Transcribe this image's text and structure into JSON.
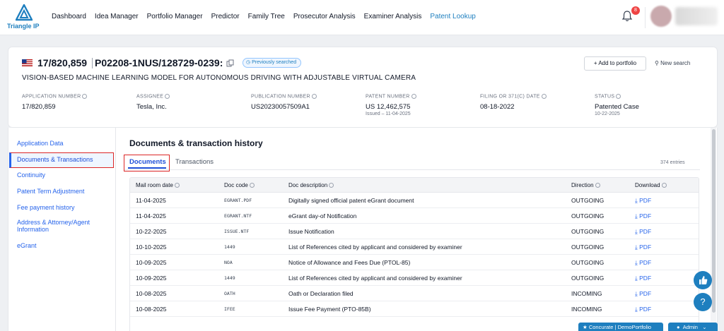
{
  "brand": {
    "name": "Triangle IP",
    "color": "#1e7fbf"
  },
  "nav": {
    "items": [
      "Dashboard",
      "Idea Manager",
      "Portfolio Manager",
      "Predictor",
      "Family Tree",
      "Prosecutor Analysis",
      "Examiner Analysis",
      "Patent Lookup"
    ],
    "active": "Patent Lookup"
  },
  "notifications": {
    "count": "8"
  },
  "header": {
    "application_number": "17/820,859",
    "docket": "P02208-1NUS/128729-0239:",
    "badge": "Previously searched",
    "title": "VISION-BASED MACHINE LEARNING MODEL FOR AUTONOMOUS DRIVING WITH ADJUSTABLE VIRTUAL CAMERA",
    "add_portfolio": "+ Add to portfolio",
    "new_search": "New search",
    "fields": [
      {
        "label": "APPLICATION NUMBER",
        "value": "17/820,859",
        "sub": ""
      },
      {
        "label": "ASSIGNEE",
        "value": "Tesla, Inc.",
        "sub": ""
      },
      {
        "label": "PUBLICATION NUMBER",
        "value": "US20230057509A1",
        "sub": ""
      },
      {
        "label": "PATENT NUMBER",
        "value": "US 12,462,575",
        "sub": "Issued – 11-04-2025"
      },
      {
        "label": "FILING OR 371(C) DATE",
        "value": "08-18-2022",
        "sub": ""
      },
      {
        "label": "STATUS",
        "value": "Patented Case",
        "sub": "10-22-2025"
      }
    ]
  },
  "sidebar": {
    "items": [
      "Application Data",
      "Documents & Transactions",
      "Continuity",
      "Patent Term Adjustment",
      "Fee payment history",
      "Address & Attorney/Agent Information",
      "eGrant"
    ],
    "active": "Documents & Transactions"
  },
  "main": {
    "section_title": "Documents & transaction history",
    "tabs": [
      "Documents",
      "Transactions"
    ],
    "entries": "374 entries",
    "columns": [
      "Mail room date",
      "Doc code",
      "Doc description",
      "Direction",
      "Download"
    ],
    "rows": [
      {
        "date": "11-04-2025",
        "code": "EGRANT.PDF",
        "desc": "Digitally signed official patent eGrant document",
        "dir": "OUTGOING",
        "dl": "PDF"
      },
      {
        "date": "11-04-2025",
        "code": "EGRANT.NTF",
        "desc": "eGrant day-of Notification",
        "dir": "OUTGOING",
        "dl": "PDF"
      },
      {
        "date": "10-22-2025",
        "code": "ISSUE.NTF",
        "desc": "Issue Notification",
        "dir": "OUTGOING",
        "dl": "PDF"
      },
      {
        "date": "10-10-2025",
        "code": "1449",
        "desc": "List of References cited by applicant and considered by examiner",
        "dir": "OUTGOING",
        "dl": "PDF"
      },
      {
        "date": "10-09-2025",
        "code": "NOA",
        "desc": "Notice of Allowance and Fees Due (PTOL-85)",
        "dir": "OUTGOING",
        "dl": "PDF"
      },
      {
        "date": "10-09-2025",
        "code": "1449",
        "desc": "List of References cited by applicant and considered by examiner",
        "dir": "OUTGOING",
        "dl": "PDF"
      },
      {
        "date": "10-08-2025",
        "code": "OATH",
        "desc": "Oath or Declaration filed",
        "dir": "INCOMING",
        "dl": "PDF"
      },
      {
        "date": "10-08-2025",
        "code": "IFEE",
        "desc": "Issue Fee Payment (PTO-85B)",
        "dir": "INCOMING",
        "dl": "PDF"
      }
    ]
  },
  "footer": {
    "concurate": "Concurate",
    "portfolio": "DemoPortfolio",
    "admin": "Admin",
    "help": "?"
  }
}
